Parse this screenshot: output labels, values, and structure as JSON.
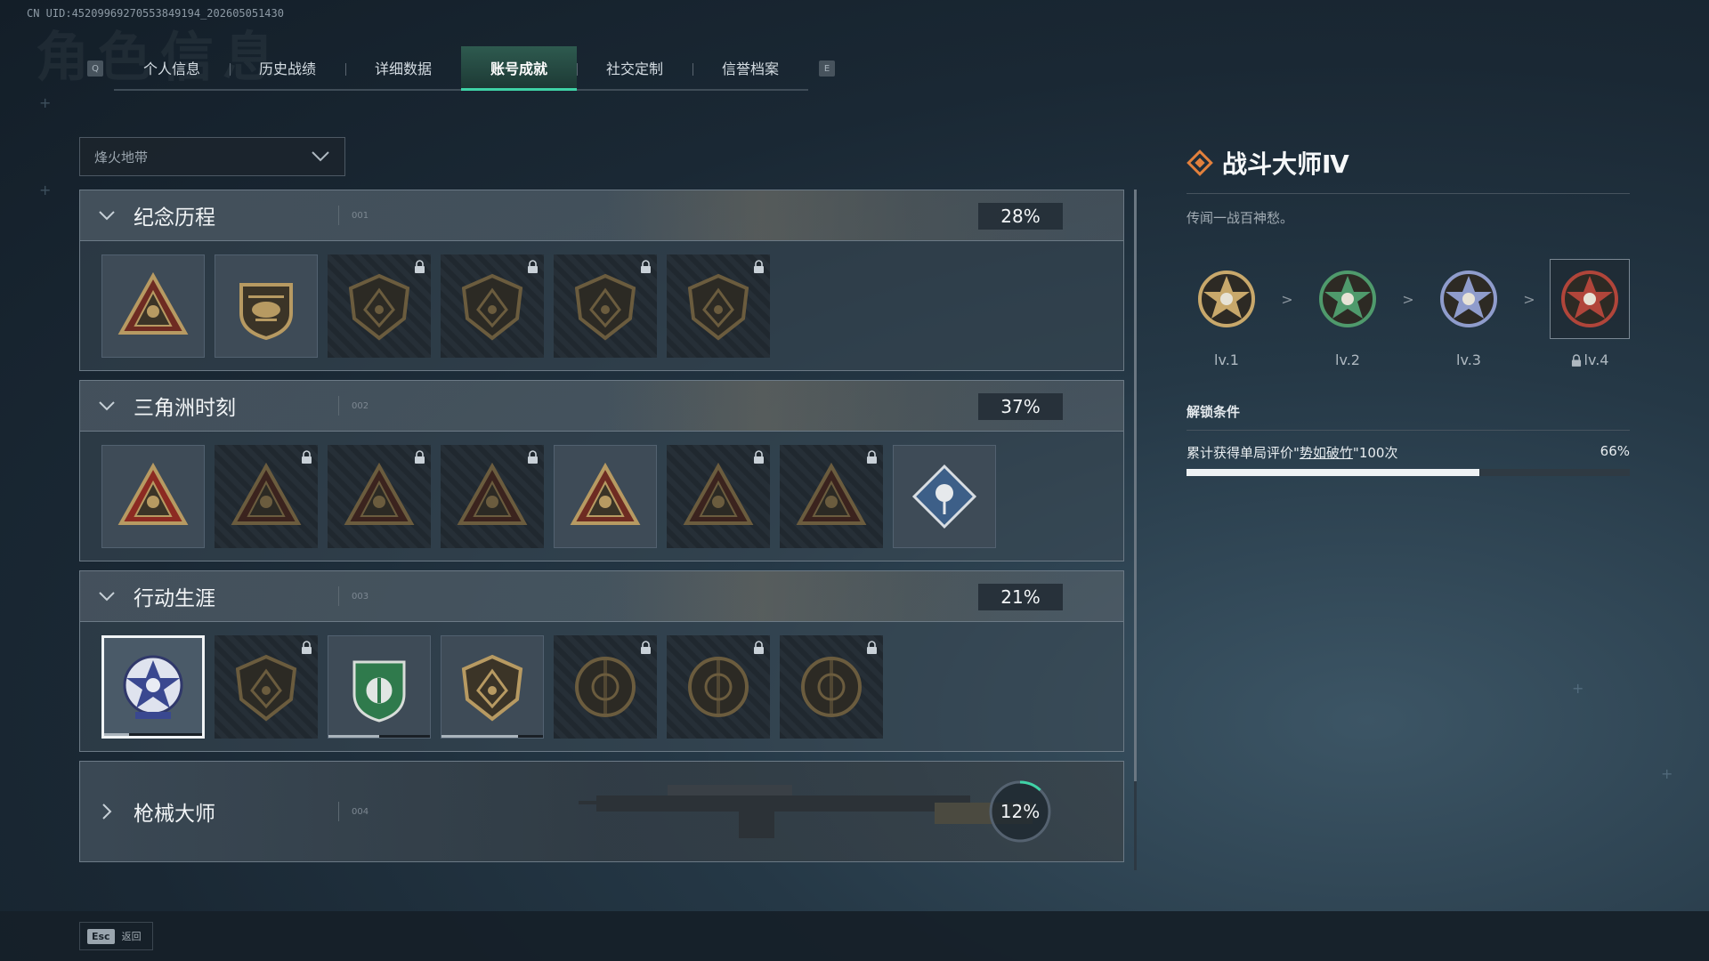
{
  "uid_text": "CN UID:4520996927055384919​4_202605051430",
  "bg_title": "角色信息",
  "tabs": {
    "key_left": "Q",
    "key_right": "E",
    "items": [
      "个人信息",
      "历史战绩",
      "详细数据",
      "账号成就",
      "社交定制",
      "信誉档案"
    ],
    "active_index": 3
  },
  "dropdown": {
    "value": "烽火地带"
  },
  "panels": [
    {
      "title": "纪念历程",
      "num": "001",
      "percent": "28%",
      "badges": [
        {
          "icon": "triangle-emblem-icon",
          "locked": false
        },
        {
          "icon": "helicopter-emblem-icon",
          "locked": false
        },
        {
          "icon": "shield-emblem-icon",
          "locked": true
        },
        {
          "icon": "tower-emblem-icon",
          "locked": true
        },
        {
          "icon": "hooded-figure-emblem-icon",
          "locked": true
        },
        {
          "icon": "skull-emblem-icon",
          "locked": true
        }
      ]
    },
    {
      "title": "三角洲时刻",
      "num": "002",
      "percent": "37%",
      "badges": [
        {
          "icon": "red-triangle-emblem-icon",
          "locked": false
        },
        {
          "icon": "triangle-emblem-icon",
          "locked": true
        },
        {
          "icon": "triangle-emblem-icon",
          "locked": true
        },
        {
          "icon": "triangle-emblem-icon",
          "locked": true
        },
        {
          "icon": "triangle-emblem-icon",
          "locked": false
        },
        {
          "icon": "triangle-emblem-icon",
          "locked": true
        },
        {
          "icon": "triangle-emblem-icon",
          "locked": true
        },
        {
          "icon": "rose-diamond-emblem-icon",
          "locked": false
        }
      ]
    },
    {
      "title": "行动生涯",
      "num": "003",
      "percent": "21%",
      "badges": [
        {
          "icon": "star-skull-emblem-icon",
          "locked": false,
          "selected": true,
          "progress": 0.25
        },
        {
          "icon": "shield-emblem-icon",
          "locked": true
        },
        {
          "icon": "green-shield-emblem-icon",
          "locked": false,
          "progress": 0.5
        },
        {
          "icon": "shield-emblem-icon",
          "locked": false,
          "progress": 0.75
        },
        {
          "icon": "round-emblem-icon",
          "locked": true
        },
        {
          "icon": "round-emblem-icon",
          "locked": true
        },
        {
          "icon": "round-emblem-icon",
          "locked": true
        }
      ]
    }
  ],
  "gun_panel": {
    "title": "枪械大师",
    "num": "004",
    "percent": "12%",
    "progress": 0.12
  },
  "detail": {
    "title": "战斗大师Ⅳ",
    "desc": "传闻一战百神愁。",
    "levels": [
      {
        "label": "lv.1",
        "color": "#c8a86b",
        "locked": false
      },
      {
        "label": "lv.2",
        "color": "#4f9a6c",
        "locked": false
      },
      {
        "label": "lv.3",
        "color": "#8f9ccc",
        "locked": false
      },
      {
        "label": "lv.4",
        "color": "#b1453a",
        "locked": true
      }
    ],
    "unlock_heading": "解锁条件",
    "condition_prefix": "累计获得单局评价\"",
    "condition_link": "势如破竹",
    "condition_suffix": "\"100次",
    "condition_percent": "66%",
    "condition_progress": 0.66
  },
  "footer": {
    "key": "Esc",
    "label": "返回"
  },
  "colors": {
    "accent": "#3fd3a6",
    "title_icon": "#e2803c"
  }
}
